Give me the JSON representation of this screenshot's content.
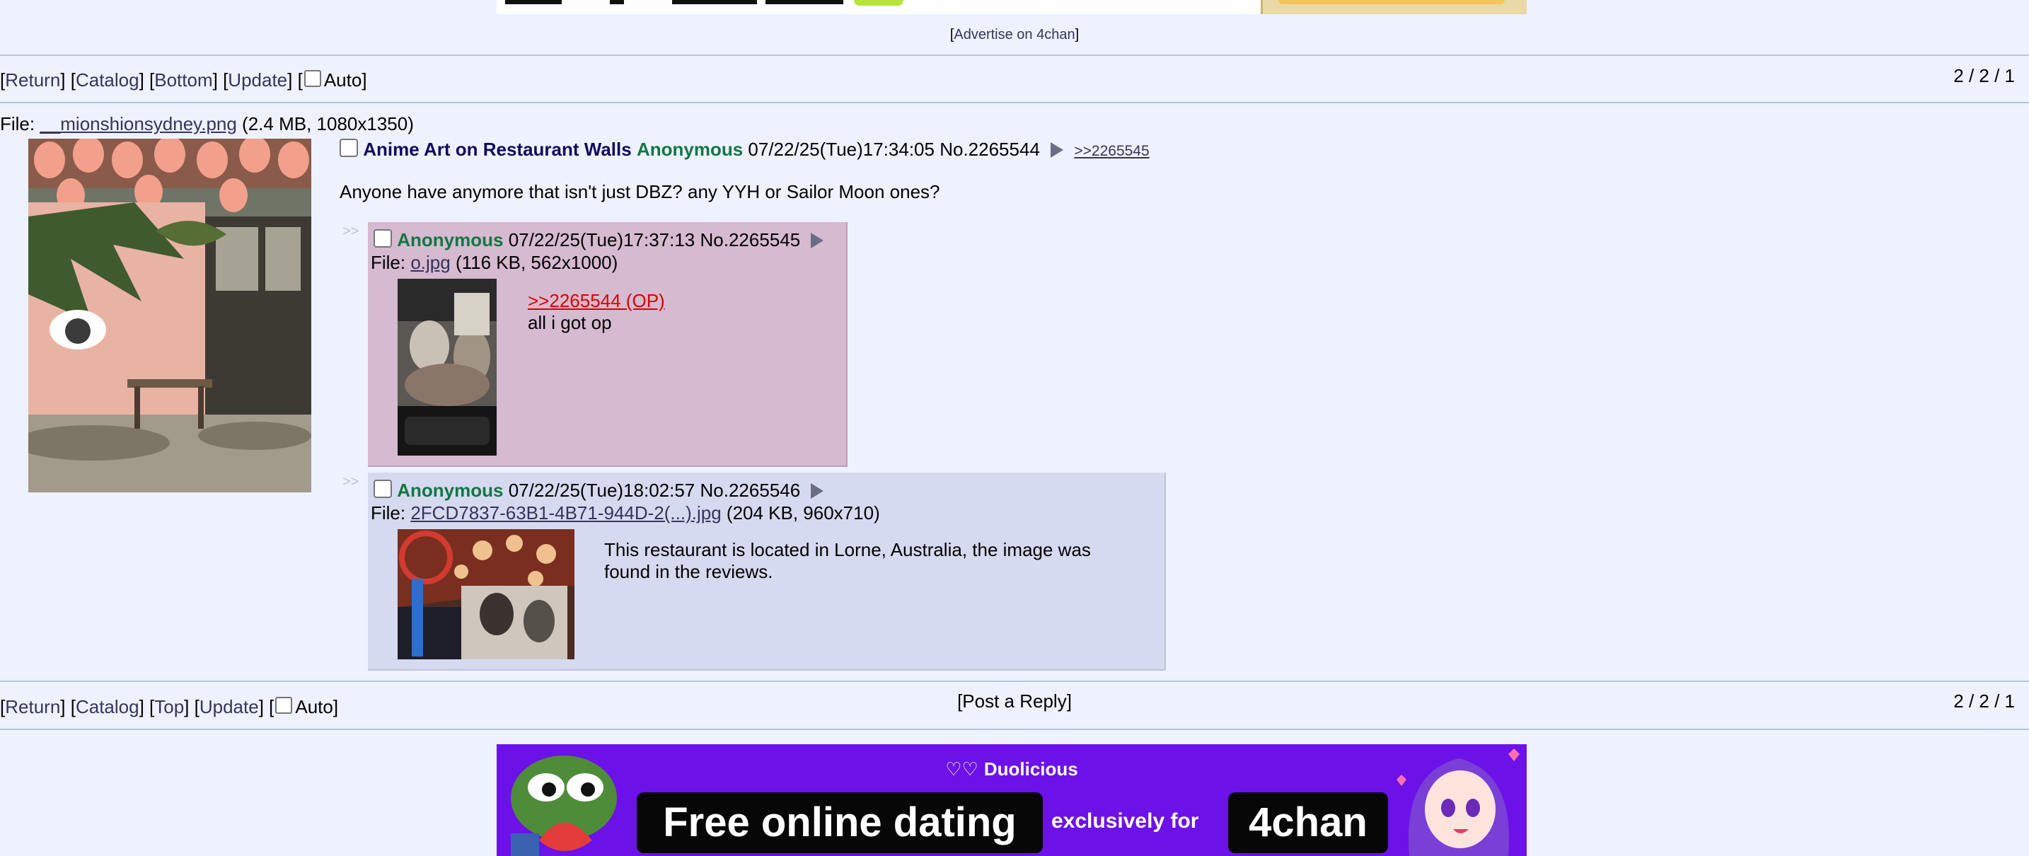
{
  "advertise_label": "Advertise on 4chan",
  "nav_top": {
    "return": "Return",
    "catalog": "Catalog",
    "bottom": "Bottom",
    "update": "Update",
    "auto": "Auto",
    "page_count": "2 / 2 / 1"
  },
  "nav_bottom": {
    "return": "Return",
    "catalog": "Catalog",
    "top": "Top",
    "update": "Update",
    "auto": "Auto",
    "page_count": "2 / 2 / 1",
    "post_reply": "Post a Reply"
  },
  "op": {
    "file_prefix": "File: ",
    "file_name": "__mionshionsydney.png",
    "file_info": " (2.4 MB, 1080x1350)",
    "subject": "Anime Art on Restaurant Walls",
    "name": "Anonymous",
    "datetime": "07/22/25(Tue)17:34:05",
    "number": "No.2265544",
    "backlink": ">>2265545",
    "message": "Anyone have anymore that isn't just DBZ? any YYH or Sailor Moon ones?"
  },
  "replies": [
    {
      "name": "Anonymous",
      "datetime": "07/22/25(Tue)17:37:13",
      "number": "No.2265545",
      "file_prefix": "File: ",
      "file_name": "o.jpg",
      "file_info": " (116 KB, 562x1000)",
      "quote": ">>2265544 (OP)",
      "message": "all i got op"
    },
    {
      "name": "Anonymous",
      "datetime": "07/22/25(Tue)18:02:57",
      "number": "No.2265546",
      "file_prefix": "File: ",
      "file_name": "2FCD7837-63B1-4B71-944D-2(...).jpg",
      "file_info": " (204 KB, 960x710)",
      "message": "This restaurant is located in Lorne, Australia, the image was found in the reviews."
    }
  ],
  "side_arrows": ">>",
  "bottom_ad": {
    "brand": "Duolicious",
    "box1": "Free online dating",
    "middle": "exclusively for",
    "box2": "4chan",
    "icon": "hearts-icon"
  },
  "colors": {
    "background": "#eef2ff",
    "name_green": "#117743",
    "subject_blue": "#0f0c5d",
    "highlight_reply": "#d6bad0",
    "reply": "#d6daf0",
    "ad_purple": "#6c12e8"
  }
}
